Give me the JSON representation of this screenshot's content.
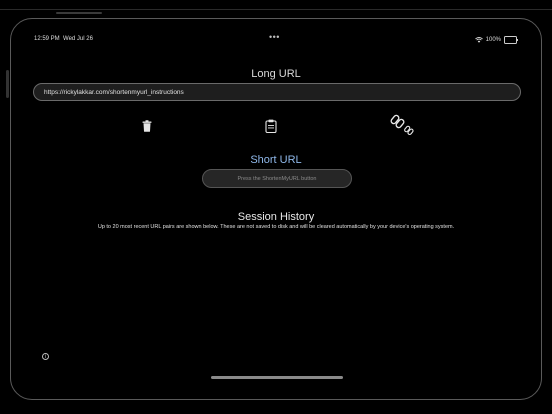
{
  "status_bar": {
    "time": "12:59 PM",
    "date": "Wed Jul 26",
    "multitask_dots": "•••",
    "battery_text": "100%"
  },
  "long_url": {
    "title": "Long URL",
    "value": "https://rickylakkar.com/shortenmyurl_instructions"
  },
  "actions": {
    "trash": "trash-icon",
    "clipboard": "clipboard-icon",
    "shorten": "link-icon"
  },
  "short_url": {
    "title": "Short URL",
    "placeholder": "Press the ShortenMyURL button"
  },
  "session_history": {
    "title": "Session History",
    "description": "Up to 20 most recent URL pairs are shown below. These are not saved to disk and will be cleared automatically by your device's operating system."
  },
  "info": {
    "glyph": "i"
  },
  "colors": {
    "background": "#000000",
    "accent_title": "#8fb8ea",
    "field_bg": "#1e1e1e",
    "field_border": "#6a6a6a"
  }
}
